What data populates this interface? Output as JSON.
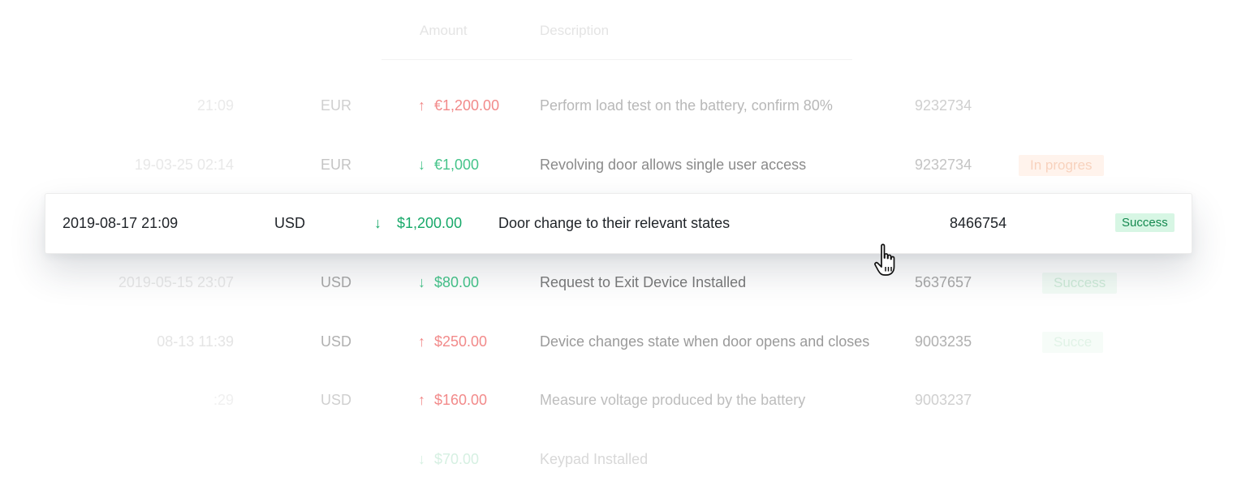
{
  "table": {
    "headers": {
      "amount": "Amount",
      "description": "Description"
    },
    "rows": [
      {
        "date": "21:09",
        "currency": "EUR",
        "direction": "up",
        "arrow": "↑",
        "amount": "€1,200.00",
        "description": "Perform load test on the battery, confirm 80%",
        "reference": "9232734",
        "status": ""
      },
      {
        "date": "19-03-25  02:14",
        "currency": "EUR",
        "direction": "down",
        "arrow": "↓",
        "amount": "€1,000",
        "description": "Revolving door allows single user access",
        "reference": "9232734",
        "status": "In progres"
      },
      {
        "date": "2019-05-15  23:07",
        "currency": "USD",
        "direction": "down",
        "arrow": "↓",
        "amount": "$80.00",
        "description": "Request to Exit Device Installed",
        "reference": "5637657",
        "status": "Success"
      },
      {
        "date": "08-13  11:39",
        "currency": "USD",
        "direction": "up",
        "arrow": "↑",
        "amount": "$250.00",
        "description": "Device changes state when door opens and closes",
        "reference": "9003235",
        "status": "Succe"
      },
      {
        "date": ":29",
        "currency": "USD",
        "direction": "up",
        "arrow": "↑",
        "amount": "$160.00",
        "description": "Measure voltage produced by the battery",
        "reference": "9003237",
        "status": ""
      },
      {
        "date": "",
        "currency": "",
        "direction": "down",
        "arrow": "↓",
        "amount": "$70.00",
        "description": "Keypad Installed",
        "reference": "",
        "status": ""
      }
    ]
  },
  "selected_row": {
    "date": "2019-08-17  21:09",
    "currency": "USD",
    "direction": "down",
    "arrow": "↓",
    "amount": "$1,200.00",
    "description": "Door change to their relevant states",
    "reference": "8466754",
    "status": "Success"
  },
  "cursor": {
    "icon": "hand-pointer-icon"
  },
  "colors": {
    "positive": "#18a96a",
    "negative": "#f28a8a",
    "success_bg": "#d7f6e4",
    "success_text": "#14894f",
    "progress_bg": "#fff3ec"
  }
}
